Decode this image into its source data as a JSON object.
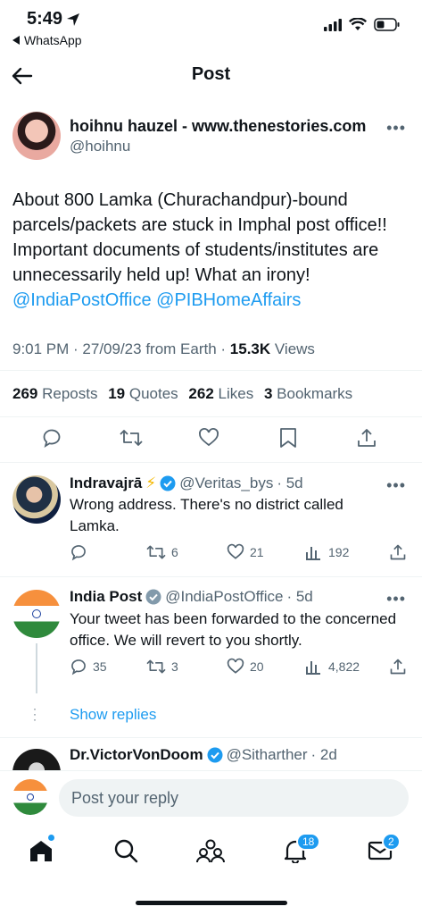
{
  "status_bar": {
    "time": "5:49",
    "back_app": "WhatsApp"
  },
  "header": {
    "title": "Post"
  },
  "main_tweet": {
    "author_name": "hoihnu hauzel - www.thenestories.com",
    "author_handle": "@hoihnu",
    "text": "About 800 Lamka (Churachandpur)-bound parcels/packets are stuck in Imphal post office!! Important documents of students/institutes are unnecessarily held up! What an irony!",
    "mentions": [
      "@IndiaPostOffice",
      "@PIBHomeAffairs"
    ],
    "meta_time": "9:01 PM · 27/09/23 from Earth · ",
    "views_count": "15.3K",
    "views_label": " Views",
    "stats": [
      {
        "count": "269",
        "label": "Reposts"
      },
      {
        "count": "19",
        "label": "Quotes"
      },
      {
        "count": "262",
        "label": "Likes"
      },
      {
        "count": "3",
        "label": "Bookmarks"
      }
    ]
  },
  "replies": [
    {
      "name": "Indravajrā",
      "emoji": "⚡",
      "handle": "@Veritas_bys",
      "age": "· 5d",
      "text": "Wrong address. There's no district called Lamka.",
      "reposts": "6",
      "likes": "21",
      "views": "192"
    },
    {
      "name": "India Post",
      "handle": "@IndiaPostOffice",
      "age": "· 5d",
      "text": "Your tweet has been forwarded to the concerned office. We will revert to you shortly.",
      "comments": "35",
      "reposts": "3",
      "likes": "20",
      "views": "4,822"
    },
    {
      "name": "Dr.VictorVonDoom",
      "handle": "@Sitharther",
      "age": "· 2d"
    }
  ],
  "show_replies": "Show replies",
  "reply_bar": {
    "placeholder": "Post your reply"
  },
  "tabbar": {
    "notifications_badge": "18",
    "messages_badge": "2"
  },
  "colors": {
    "accent": "#1d9bf0",
    "muted": "#536471",
    "text": "#0f1419"
  }
}
